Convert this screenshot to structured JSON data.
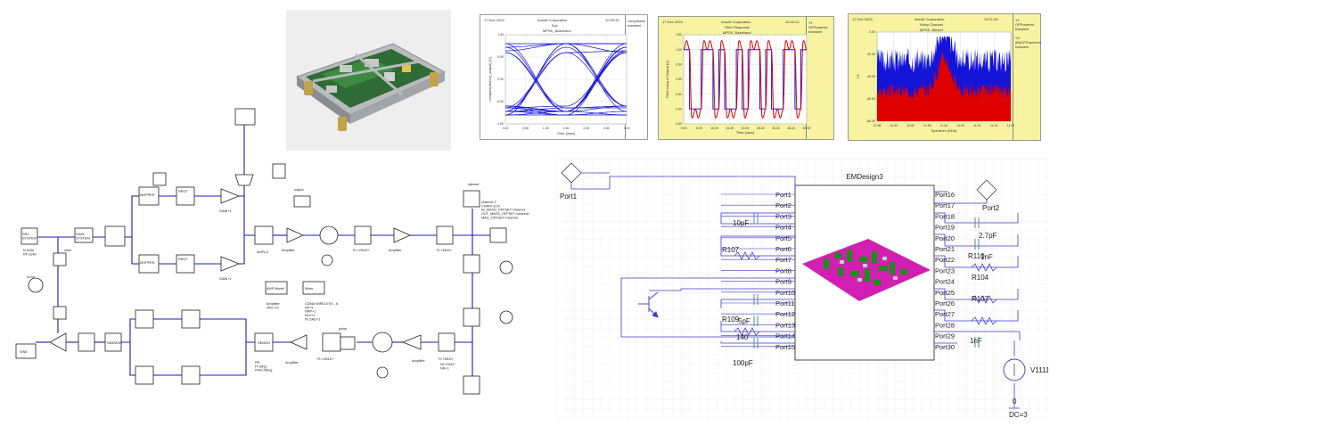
{
  "eye_plot": {
    "date": "17 Dec 2003",
    "company": "Ansoft Corporation",
    "title": "Eye",
    "subtitle": "MPSK_Baseband",
    "time": "10:25:33",
    "legend": "compliance\ntransient",
    "xlabel": "Time [usec]",
    "ylabel": "complex(demod_output) [V]",
    "x_ticks": [
      "0.00",
      "0.50",
      "1.00",
      "1.50",
      "2.00",
      "2.50",
      "3.00"
    ],
    "y_ticks": [
      "1.00",
      "0.50",
      "0.00",
      "-0.50",
      "-1.00"
    ]
  },
  "filter_plot": {
    "date": "17 Dec 2003",
    "company": "Ansoft Corporation",
    "title": "Filter Response",
    "subtitle": "MPSK_Baseband",
    "time": "10:23:12",
    "legend": "Y1\nOFPowered\ntransient",
    "xlabel": "Time [usec]",
    "ylabel": "Filter Input & Output [V]",
    "x_ticks": [
      "0.00",
      "5.00",
      "10.00",
      "15.00",
      "20.00",
      "25.00",
      "30.00",
      "35.00",
      "40.00"
    ],
    "y_ticks": [
      "1.50",
      "1.00",
      "0.50",
      "0.00",
      "-0.50",
      "-1.00",
      "-1.50"
    ]
  },
  "noisy_plot": {
    "date": "17 Dec 2003",
    "company": "Ansoft Corporation",
    "title": "Noisy Channel",
    "subtitle": "MPSK_filtered",
    "time": "10:21:06",
    "legend": "Y1\nOFPowered\ntransient",
    "legend2": "Y2\ndB(OFPowered)\ntransient",
    "xlabel": "Spectrum [GHz]",
    "ylabel": "Y1",
    "x_ticks": [
      "10.98",
      "10.99",
      "10.99",
      "10.99",
      "11.00",
      "11.00",
      "11.01",
      "11.01",
      "11.02"
    ],
    "y_ticks": [
      "0.00",
      "-20.00",
      "-40.00",
      "-60.00",
      "-80.00"
    ]
  },
  "left_schematic": {
    "labels": {
      "rfsrc": "SRC\nSYSTEM",
      "src_params": "N:4e4b\nRF:1e4b",
      "lo": "lo-lon",
      "ofuel": "ofuel",
      "gain_a": "GAIN\nSYSTEM",
      "mod_i": "MOPPER",
      "mod_q": "MOPPER",
      "rrcf_i": "RRCF",
      "rrcf_q": "RRCF",
      "gain_i": "GAIN+1",
      "gain_q": "GAIN+1",
      "mixer": "AMFLO",
      "amp1": "Amplifier",
      "bpf1": "FL+2N1D+",
      "amp2": "Amplifier",
      "bpf2": "FL+M1D+",
      "amp_hdr": "AMP Model",
      "mixer_hdr": "Mixer",
      "amp_param": "Amplifier\nNF2+10",
      "mixer_param": "CDMA WIRELESS - 6\nNF=5\nNRP+1\nNL0+1\nPLOAD=1",
      "channel": "channel-1\nCHAN+1CN\nIN_MAG0_OFFSET=channel\nOUT_MAG0_OFFSET=channel\nMAG_OFFSET=channel",
      "output": "output",
      "input_lbl": "ofpowd",
      "demod": "DEMOD",
      "pulse": "pulse",
      "ndemod": "NDEMOD",
      "sink": "SINK",
      "pulse2": "PR\nP+5ling\nPHID+5ling",
      "rx_amp": "Amplifier",
      "rx_bpf": "FL+2N1D+",
      "rx_amp2": "Amplifier",
      "rx_bpf2": "FL+M1D+",
      "nl": "NL+N1D+\nNR+1"
    }
  },
  "right_schematic": {
    "title": "EMDesign3",
    "port1": "Port1",
    "port2": "Port2",
    "left_ports": [
      "Port1",
      "Port2",
      "Port3",
      "Port4",
      "Port5",
      "Port6",
      "Port7",
      "Port8",
      "Port9",
      "Port10",
      "Port11",
      "Port12",
      "Port13",
      "Port14",
      "Port15"
    ],
    "right_ports": [
      "Port16",
      "Port17",
      "Port18",
      "Port19",
      "Port20",
      "Port21",
      "Port22",
      "Port23",
      "Port24",
      "Port25",
      "Port26",
      "Port27",
      "Port28",
      "Port29",
      "Port30"
    ],
    "components": {
      "c_10pf": "10pF",
      "r_107": "R107",
      "c_2_7pf": "2.7pF",
      "r_110": "R110",
      "c_1nf_a": "1nF",
      "r_104": "R104",
      "r_107b": "R107",
      "r_109": "R109",
      "c_5pf": "5pF",
      "c_140": "140",
      "c_100pf": "100pF",
      "c_1nf_b": "1nF",
      "v_src": "V1111",
      "dc": "DC=3",
      "gnd": "0"
    }
  },
  "colors": {
    "wire_blue": "#1d1dbb",
    "sch_right_wire": "#3b3bd0",
    "cap_color": "#5f8fa8",
    "plot_blue": "#1414d8",
    "plot_red": "#e00000",
    "pcb_magenta": "#d21fb1",
    "pcb_green": "#1c8c1c",
    "panel_yellow": "#f7f3a0"
  }
}
